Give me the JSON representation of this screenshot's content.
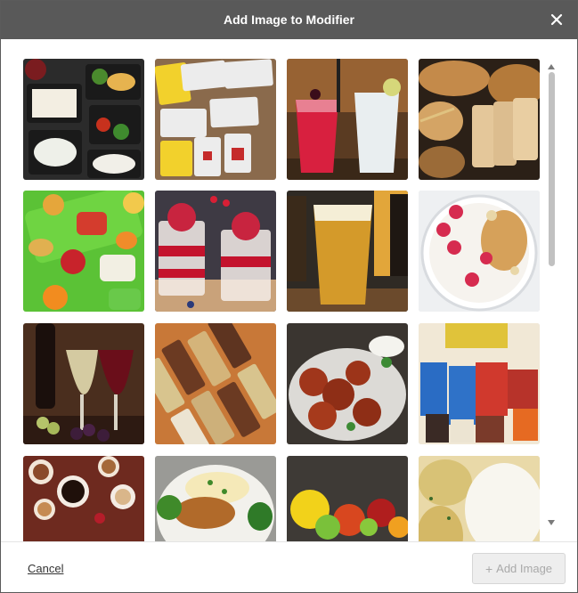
{
  "dialog": {
    "title": "Add Image to Modifier",
    "close_icon": "close-icon"
  },
  "images": [
    {
      "name": "meal-prep-containers"
    },
    {
      "name": "condiment-packets"
    },
    {
      "name": "red-and-clear-cocktails"
    },
    {
      "name": "bread-loaves"
    },
    {
      "name": "school-lunch-trays"
    },
    {
      "name": "raspberry-parfaits"
    },
    {
      "name": "beer-glasses"
    },
    {
      "name": "yogurt-granola-bowl"
    },
    {
      "name": "wine-glasses-grapes"
    },
    {
      "name": "granola-bars"
    },
    {
      "name": "glazed-chicken-wings"
    },
    {
      "name": "chips-and-snacks"
    },
    {
      "name": "coffee-cups"
    },
    {
      "name": "chicken-and-mashed-potatoes"
    },
    {
      "name": "fruit-assortment"
    },
    {
      "name": "rice-and-potatoes"
    }
  ],
  "footer": {
    "cancel_label": "Cancel",
    "add_label": "Add Image",
    "add_icon": "plus-icon"
  },
  "colors": {
    "titlebar": "#595959",
    "disabled_button_bg": "#eeeeee",
    "disabled_button_text": "#a9a9a9"
  }
}
